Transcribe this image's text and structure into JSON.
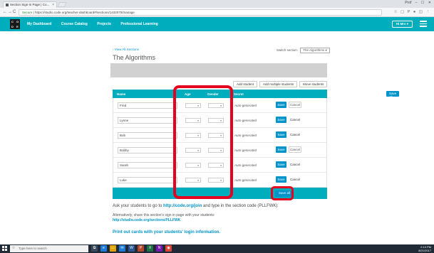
{
  "browser": {
    "tab_title": "Section Sign-in Page | Co...",
    "tab_close": "×",
    "window_controls": [
      "Prof",
      "–",
      "☐",
      "✕"
    ],
    "back_icon": "←",
    "forward_icon": "→",
    "reload_icon": "C",
    "home_icon": "⌂",
    "secure_label": "Secure",
    "url": "https://studio.code.org/teacher-dashboard#/sections/1432070/manage",
    "ext_icons": [
      "☆",
      "▢",
      "P",
      "●",
      "◫",
      "⋮"
    ]
  },
  "site": {
    "logo_letters": [
      "C",
      "O",
      "D",
      "E"
    ],
    "nav": [
      "My Dashboard",
      "Course Catalog",
      "Projects",
      "Professional Learning"
    ],
    "user_label": "Hi Mrs ▾"
  },
  "section": {
    "view_all": "‹ View All Sections",
    "title": "The Algorithms",
    "switch_label": "Switch section:",
    "switch_value": "The Algorithms ▾"
  },
  "actions": [
    "Add student",
    "Add multiple students",
    "Move students"
  ],
  "table": {
    "headers": {
      "name": "Name",
      "age": "Age",
      "gender": "Gender",
      "secret": "Secret",
      "save_all": "Save all"
    },
    "dropdown_glyph": "▾",
    "rows": [
      {
        "name": "Fred",
        "editing": true,
        "password": "Auto-generated",
        "save": "Save",
        "cancel": "Cancel"
      },
      {
        "name": "Lynne",
        "editing": false,
        "password": "Auto-generated",
        "save": "Save",
        "cancel": "Cancel"
      },
      {
        "name": "Bob",
        "editing": false,
        "password": "Auto-generated",
        "save": "Save",
        "cancel": "Cancel"
      },
      {
        "name": "Bobby",
        "editing": true,
        "password": "Auto-generated",
        "save": "Save",
        "cancel": "Cancel"
      },
      {
        "name": "Sarah",
        "editing": false,
        "password": "Auto-generated",
        "save": "Save",
        "cancel": "Cancel"
      },
      {
        "name": "Luke",
        "editing": false,
        "password": "Auto-generated",
        "save": "Save",
        "cancel": "Cancel"
      }
    ],
    "save_all_footer": "Save all"
  },
  "instructions": {
    "line1_prefix": "Ask your students to go to ",
    "line1_link": "http://code.org/join",
    "line1_suffix": " and type in the section code (PLLFWK)",
    "line2": "Alternatively, share this section's sign in page with your students:",
    "line3_link": "http://studio.code.org/sections/PLLFWK",
    "line4": "Print out cards with your students' login information."
  },
  "taskbar": {
    "search_placeholder": "Type here to search",
    "icons": [
      {
        "glyph": "⧉",
        "color": "#3a4a5c"
      },
      {
        "glyph": "e",
        "color": "#1f7ad6"
      },
      {
        "glyph": "▭",
        "color": "#e0a100"
      },
      {
        "glyph": "✉",
        "color": "#1f7ad6"
      },
      {
        "glyph": "W",
        "color": "#2b5797"
      },
      {
        "glyph": "P",
        "color": "#b7472a"
      },
      {
        "glyph": "X",
        "color": "#1e7145"
      },
      {
        "glyph": "N",
        "color": "#7719aa"
      },
      {
        "glyph": "◉",
        "color": "#db4437"
      }
    ],
    "tray_time": "2:13 PM",
    "tray_date": "8/21/2017"
  },
  "colors": {
    "brand_teal": "#00adbc",
    "button_blue": "#0094ca",
    "highlight_red": "#e5001f"
  }
}
